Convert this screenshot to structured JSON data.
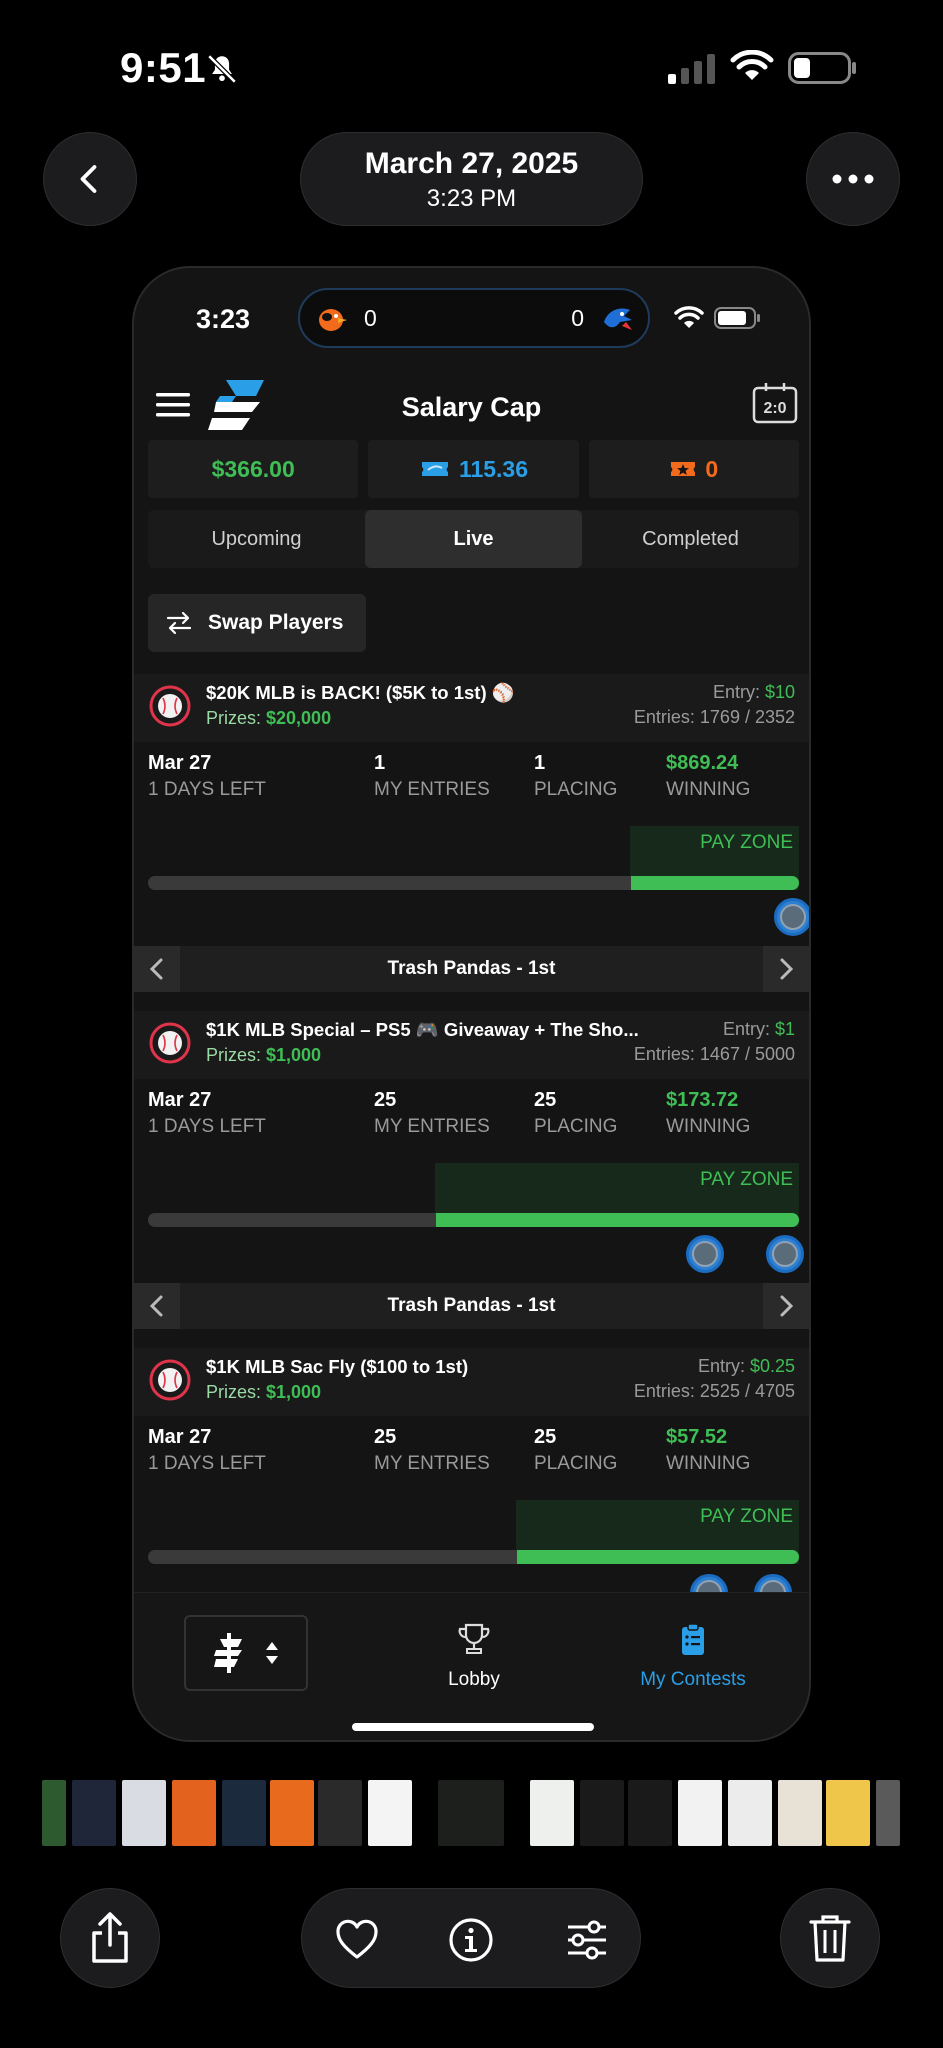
{
  "os_status": {
    "time": "9:51"
  },
  "viewer": {
    "date": "March 27, 2025",
    "time": "3:23 PM"
  },
  "phone_status": {
    "time": "3:23",
    "live_game": {
      "away_score": "0",
      "home_score": "0"
    }
  },
  "app": {
    "title": "Salary Cap",
    "balances": {
      "cash": "$366.00",
      "tickets": "115.36",
      "crowns": "0"
    },
    "tabs": [
      {
        "label": "Upcoming",
        "active": false
      },
      {
        "label": "Live",
        "active": true
      },
      {
        "label": "Completed",
        "active": false
      }
    ],
    "swap_label": "Swap Players"
  },
  "labels": {
    "entry": "Entry: ",
    "entries": "Entries: ",
    "prizes": "Prizes: ",
    "days_left": "1 DAYS LEFT",
    "my_entries": "MY ENTRIES",
    "placing": "PLACING",
    "winning": "WINNING",
    "pay_zone": "PAY ZONE"
  },
  "contests": [
    {
      "name": "$20K MLB is BACK! ($5K to 1st) ⚾",
      "prizes": "$20,000",
      "entry": "$10",
      "entries": "1769 / 2352",
      "date": "Mar 27",
      "my_entries": "1",
      "placing": "1",
      "winning": "$869.24",
      "pay_zone_fraction": 0.26,
      "team": "Trash Pandas - 1st"
    },
    {
      "name": "$1K MLB Special – PS5 🎮 Giveaway + The Sho...",
      "prizes": "$1,000",
      "entry": "$1",
      "entries": "1467 / 5000",
      "date": "Mar 27",
      "my_entries": "25",
      "placing": "25",
      "winning": "$173.72",
      "pay_zone_fraction": 0.56,
      "team": "Trash Pandas - 1st"
    },
    {
      "name": "$1K MLB Sac Fly ($100 to 1st)",
      "prizes": "$1,000",
      "entry": "$0.25",
      "entries": "2525 / 4705",
      "date": "Mar 27",
      "my_entries": "25",
      "placing": "25",
      "winning": "$57.52",
      "pay_zone_fraction": 0.44
    }
  ],
  "bottom_nav": {
    "lobby": "Lobby",
    "my_contests": "My Contests"
  },
  "colors": {
    "green": "#3fbe55",
    "blue": "#2a9ee6",
    "orange": "#f26a1b",
    "background": "#141414"
  }
}
